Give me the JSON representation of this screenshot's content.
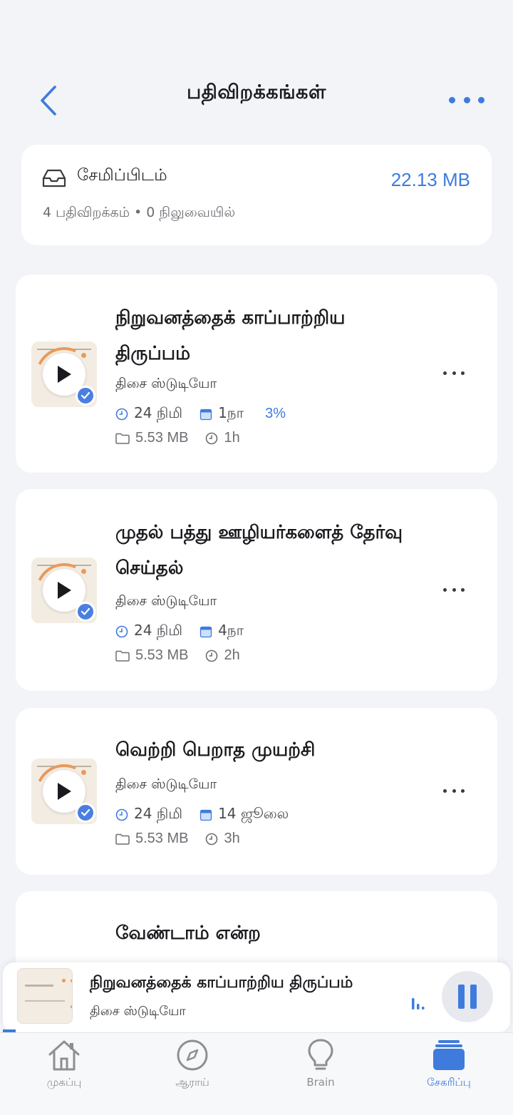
{
  "header": {
    "title": "பதிவிறக்கங்கள்"
  },
  "storage": {
    "label": "சேமிப்பிடம்",
    "size": "22.13 MB",
    "summary": "4 பதிவிறக்கம் • 0 நிலுவையில்",
    "icon": "tray-icon"
  },
  "episodes": [
    {
      "title": "நிறுவனத்தைக் காப்பாற்றிய திருப்பம்",
      "author": "திசை ஸ்டுடியோ",
      "duration": "24 நிமி",
      "date": "1நா",
      "progress": "3%",
      "file_size": "5.53 MB",
      "downloaded_ago": "1h"
    },
    {
      "title": "முதல் பத்து ஊழியர்களைத் தேர்வு செய்தல்",
      "author": "திசை ஸ்டுடியோ",
      "duration": "24 நிமி",
      "date": "4நா",
      "progress": "",
      "file_size": "5.53 MB",
      "downloaded_ago": "2h"
    },
    {
      "title": "வெற்றி பெறாத முயற்சி",
      "author": "திசை ஸ்டுடியோ",
      "duration": "24 நிமி",
      "date": "14 ஜூலை",
      "progress": "",
      "file_size": "5.53 MB",
      "downloaded_ago": "3h"
    },
    {
      "title": "வேண்டாம் என்ற"
    }
  ],
  "mini_player": {
    "title": "நிறுவனத்தைக் காப்பாற்றிய திருப்பம்",
    "author": "திசை ஸ்டுடியோ"
  },
  "tabs": [
    {
      "label": "முகப்பு",
      "icon": "home-icon",
      "active": false
    },
    {
      "label": "ஆராய்",
      "icon": "compass-icon",
      "active": false
    },
    {
      "label": "Brain",
      "icon": "lightbulb-icon",
      "active": false
    },
    {
      "label": "சேகரிப்பு",
      "icon": "library-icon",
      "active": true
    }
  ],
  "colors": {
    "accent": "#3f7bdc",
    "background": "#f2f4f8",
    "card": "#ffffff",
    "thumb_orange": "#e89a5c"
  }
}
